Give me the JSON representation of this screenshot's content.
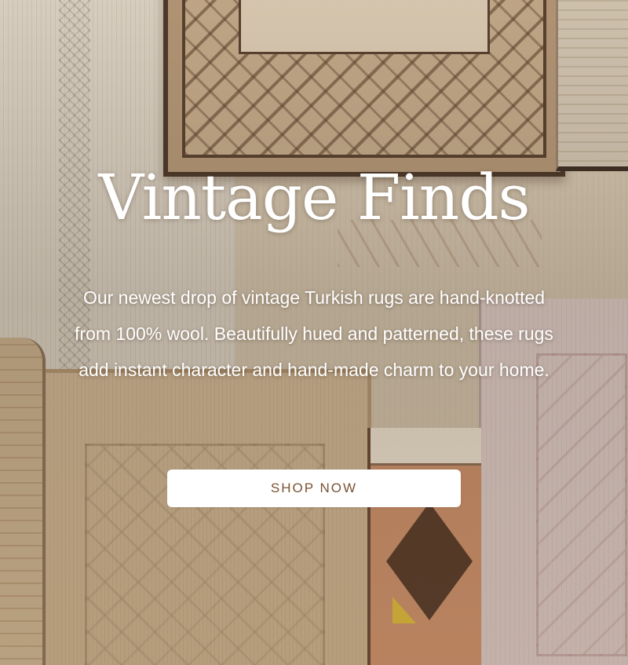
{
  "hero": {
    "title": "Vintage Finds",
    "description": "Our newest drop of vintage Turkish rugs are hand-knotted from 100% wool. Beautifully hued and patterned, these rugs add instant character and hand-made charm to your home.",
    "cta_label": "SHOP NOW",
    "background_image": "vintage-turkish-rugs-collage"
  },
  "colors": {
    "text": "#ffffff",
    "button_bg": "#ffffff",
    "button_text": "#7a5233"
  }
}
